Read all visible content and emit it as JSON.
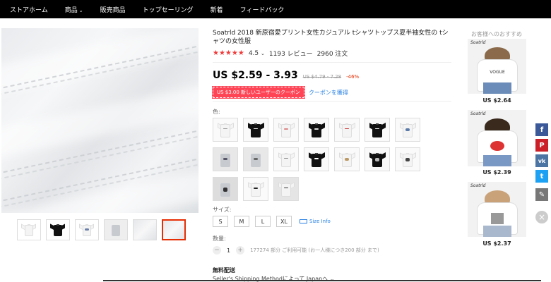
{
  "nav": {
    "items": [
      "ストアホーム",
      "商品",
      "販売商品",
      "トップセーリング",
      "新着",
      "フィードバック"
    ],
    "chevron": "⌄"
  },
  "product": {
    "title": "Soatrld 2018 新原宿愛プリント女性カジュアル tシャツトップス夏半袖女性の tシャツの女性服",
    "rating": "4.5",
    "rating_chevron": "⌄",
    "stars": "★★★★★",
    "reviews": "1193 レビュー",
    "orders": "2960 注文",
    "price": "US $2.59 - 3.93",
    "old_price": "US $4.79 - 7.28",
    "discount": "-46%",
    "coupon": "US $3.00 新しいユーザーのクーポン",
    "coupon_link": "クーポンを獲得",
    "color_label": "色:",
    "size_label": "サイズ:",
    "sizes": [
      "S",
      "M",
      "L",
      "XL"
    ],
    "size_info": "Size Info",
    "qty_label": "数量:",
    "qty_minus": "−",
    "qty_value": "1",
    "qty_plus": "+",
    "stock": "177274 部分 ご利用可能 (お一人様につき200 部分 まで)",
    "shipping_title": "無料配送",
    "shipping_method": "Seller's Shipping Methodによって Japanへ ⌄"
  },
  "recommend": {
    "title": "お客様へのおすすめ",
    "items": [
      {
        "brand": "Soatrld",
        "print": "VOGUE",
        "price": "US $2.64"
      },
      {
        "brand": "Soatrld",
        "print": "",
        "price": "US $2.39"
      },
      {
        "brand": "Soatrld",
        "print": "",
        "price": "US $2.37"
      }
    ]
  },
  "share": {
    "facebook": "f",
    "pinterest": "P",
    "vk": "vk",
    "twitter": "t",
    "edit": "✎",
    "close": "×"
  },
  "colors": {
    "star": "#f03c3c",
    "accent_red": "#e62e04",
    "link_blue": "#2a82e4",
    "facebook": "#3b5998",
    "pinterest": "#cb2027",
    "vk": "#4c75a3",
    "twitter": "#1da1f2",
    "edit": "#777777"
  }
}
